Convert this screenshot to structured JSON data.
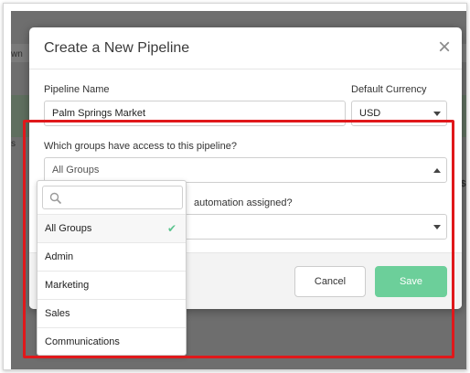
{
  "background": {
    "fragments": [
      "wn",
      "s",
      "$"
    ]
  },
  "modal": {
    "title": "Create a New Pipeline",
    "close_icon": "close-icon",
    "pipeline_name": {
      "label": "Pipeline Name",
      "value": "Palm Springs Market"
    },
    "currency": {
      "label": "Default Currency",
      "value": "USD"
    },
    "groups": {
      "label": "Which groups have access to this pipeline?",
      "value": "All Groups"
    },
    "automation": {
      "label_fragment": "automation assigned?"
    },
    "footer": {
      "cancel_label": "Cancel",
      "save_label": "Save"
    }
  },
  "dropdown": {
    "search_placeholder": "",
    "search_icon": "search-icon",
    "items": [
      {
        "label": "All Groups",
        "selected": true
      },
      {
        "label": "Admin",
        "selected": false
      },
      {
        "label": "Marketing",
        "selected": false
      },
      {
        "label": "Sales",
        "selected": false
      },
      {
        "label": "Communications",
        "selected": false
      }
    ]
  },
  "colors": {
    "save_button": "#6ccf9a",
    "check": "#5cc48f",
    "highlight": "#e0181b"
  }
}
